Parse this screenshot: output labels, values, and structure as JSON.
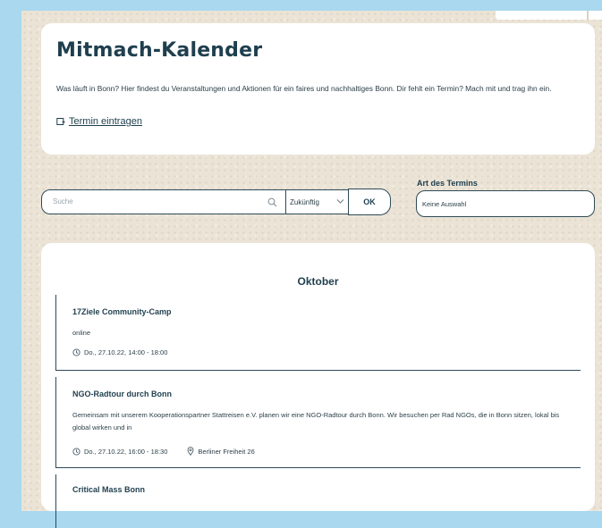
{
  "intro": {
    "title": "Mitmach-Kalender",
    "description": "Was läuft in Bonn? Hier findest du Veranstaltungen und Aktionen für ein faires und nachhaltiges Bonn. Dir fehlt ein Termin? Mach mit und trag ihn ein.",
    "add_link_label": "Termin eintragen"
  },
  "search": {
    "placeholder": "Suche",
    "time_filter_value": "Zukünftig",
    "ok_label": "OK"
  },
  "type_filter": {
    "label": "Art des Termins",
    "value": "Keine Auswahl"
  },
  "events": {
    "month": "Oktober",
    "items": [
      {
        "title": "17Ziele Community-Camp",
        "description": "online",
        "datetime": "Do., 27.10.22, 14:00 - 18:00",
        "location": ""
      },
      {
        "title": "NGO-Radtour durch Bonn",
        "description": "Gemeinsam mit unserem Kooperationspartner Stattreisen e.V. planen wir eine NGO-Radtour durch Bonn. Wir besuchen per Rad NGOs, die in Bonn sitzen, lokal bis global wirken und in",
        "datetime": "Do., 27.10.22, 16:00 - 18:30",
        "location": "Berliner Freiheit 26"
      },
      {
        "title": "Critical Mass Bonn"
      }
    ]
  },
  "icons": {
    "add": "calendar-add-icon",
    "search": "search-icon",
    "chevron": "chevron-down-icon",
    "clock": "clock-icon",
    "location": "location-pin-icon"
  },
  "colors": {
    "accent": "#1f3f4e",
    "page_background": "#ebe4d6",
    "frame": "#a9d8ef"
  }
}
